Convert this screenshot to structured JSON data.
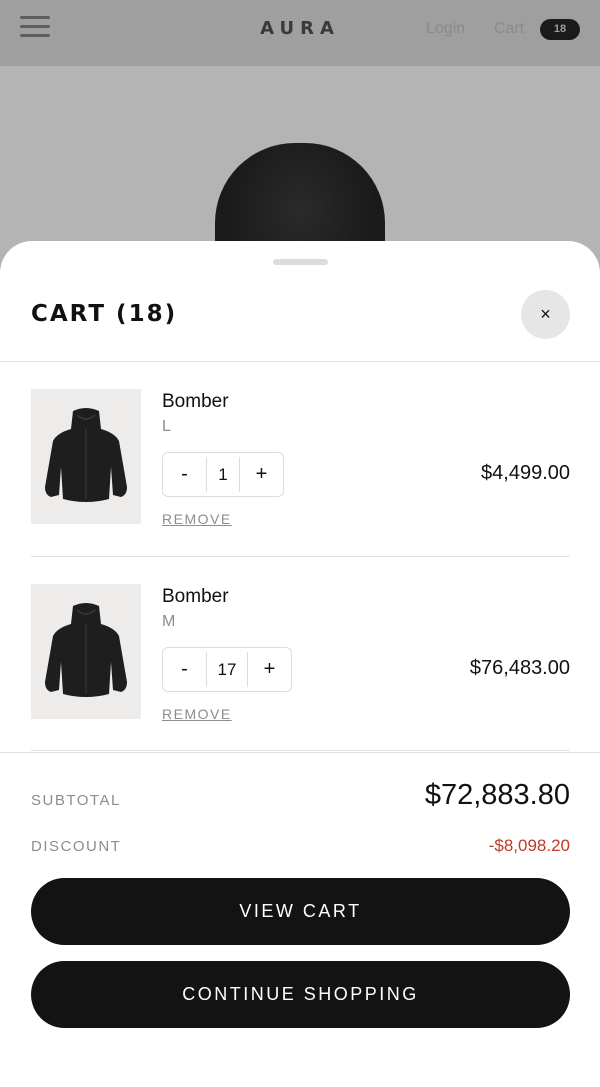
{
  "header": {
    "brand": "AURA",
    "login_label": "Login",
    "cart_label": "Cart",
    "cart_count": "18"
  },
  "cart": {
    "title": "CART (18)",
    "close_symbol": "×",
    "items": [
      {
        "name": "Bomber",
        "size": "L",
        "quantity": "1",
        "minus": "-",
        "plus": "+",
        "remove_label": "REMOVE",
        "price": "$4,499.00"
      },
      {
        "name": "Bomber",
        "size": "M",
        "quantity": "17",
        "minus": "-",
        "plus": "+",
        "remove_label": "REMOVE",
        "price": "$76,483.00"
      }
    ]
  },
  "summary": {
    "subtotal_label": "SUBTOTAL",
    "subtotal_value": "$72,883.80",
    "discount_label": "DISCOUNT",
    "discount_value": "-$8,098.20"
  },
  "actions": {
    "view_cart_label": "VIEW CART",
    "continue_label": "CONTINUE SHOPPING"
  },
  "colors": {
    "accent": "#131313",
    "discount": "#c0392b",
    "muted": "#8d8d8d"
  },
  "icons": [
    "menu-icon",
    "close-icon"
  ]
}
